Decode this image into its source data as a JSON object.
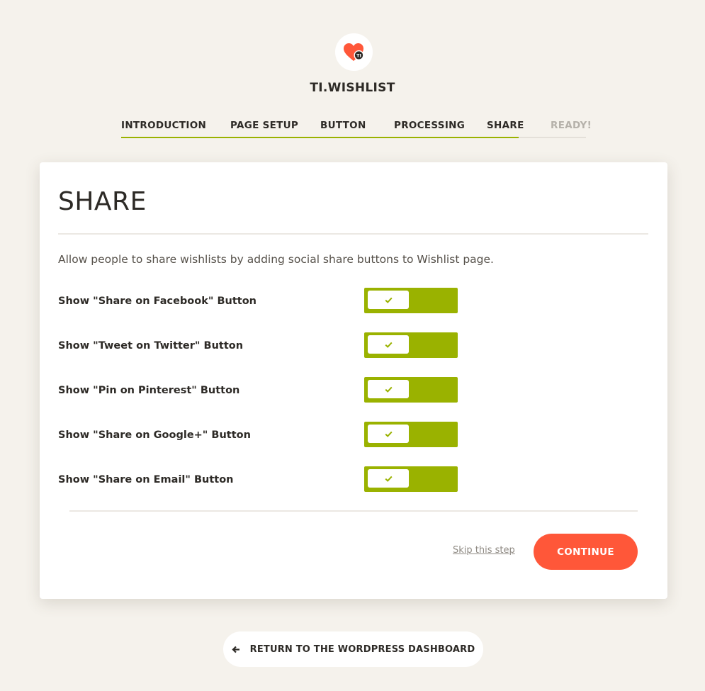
{
  "brand": {
    "name": "TI.WISHLIST",
    "logo_icon": "heart-ti-logo-icon",
    "logo_text": "TI",
    "accent_color": "#ff5739"
  },
  "steps": [
    {
      "label": "INTRODUCTION",
      "state": "done"
    },
    {
      "label": "PAGE SETUP",
      "state": "done"
    },
    {
      "label": "BUTTON",
      "state": "done"
    },
    {
      "label": "PROCESSING",
      "state": "done"
    },
    {
      "label": "SHARE",
      "state": "current"
    },
    {
      "label": "READY!",
      "state": "todo"
    }
  ],
  "card": {
    "title": "SHARE",
    "description": "Allow people to share wishlists by adding social share buttons to Wishlist page.",
    "options": [
      {
        "label": "Show \"Share on Facebook\" Button",
        "enabled": true
      },
      {
        "label": "Show \"Tweet on Twitter\" Button",
        "enabled": true
      },
      {
        "label": "Show \"Pin on Pinterest\" Button",
        "enabled": true
      },
      {
        "label": "Show \"Share on Google+\" Button",
        "enabled": true
      },
      {
        "label": "Show \"Share on Email\" Button",
        "enabled": true
      }
    ],
    "skip_label": "Skip this step",
    "continue_label": "CONTINUE"
  },
  "footer": {
    "return_label": "RETURN TO THE WORDPRESS DASHBOARD",
    "return_icon": "arrow-left-icon"
  },
  "colors": {
    "toggle_on": "#9ab200",
    "primary_button": "#ff5739",
    "background": "#f5f2ec"
  }
}
